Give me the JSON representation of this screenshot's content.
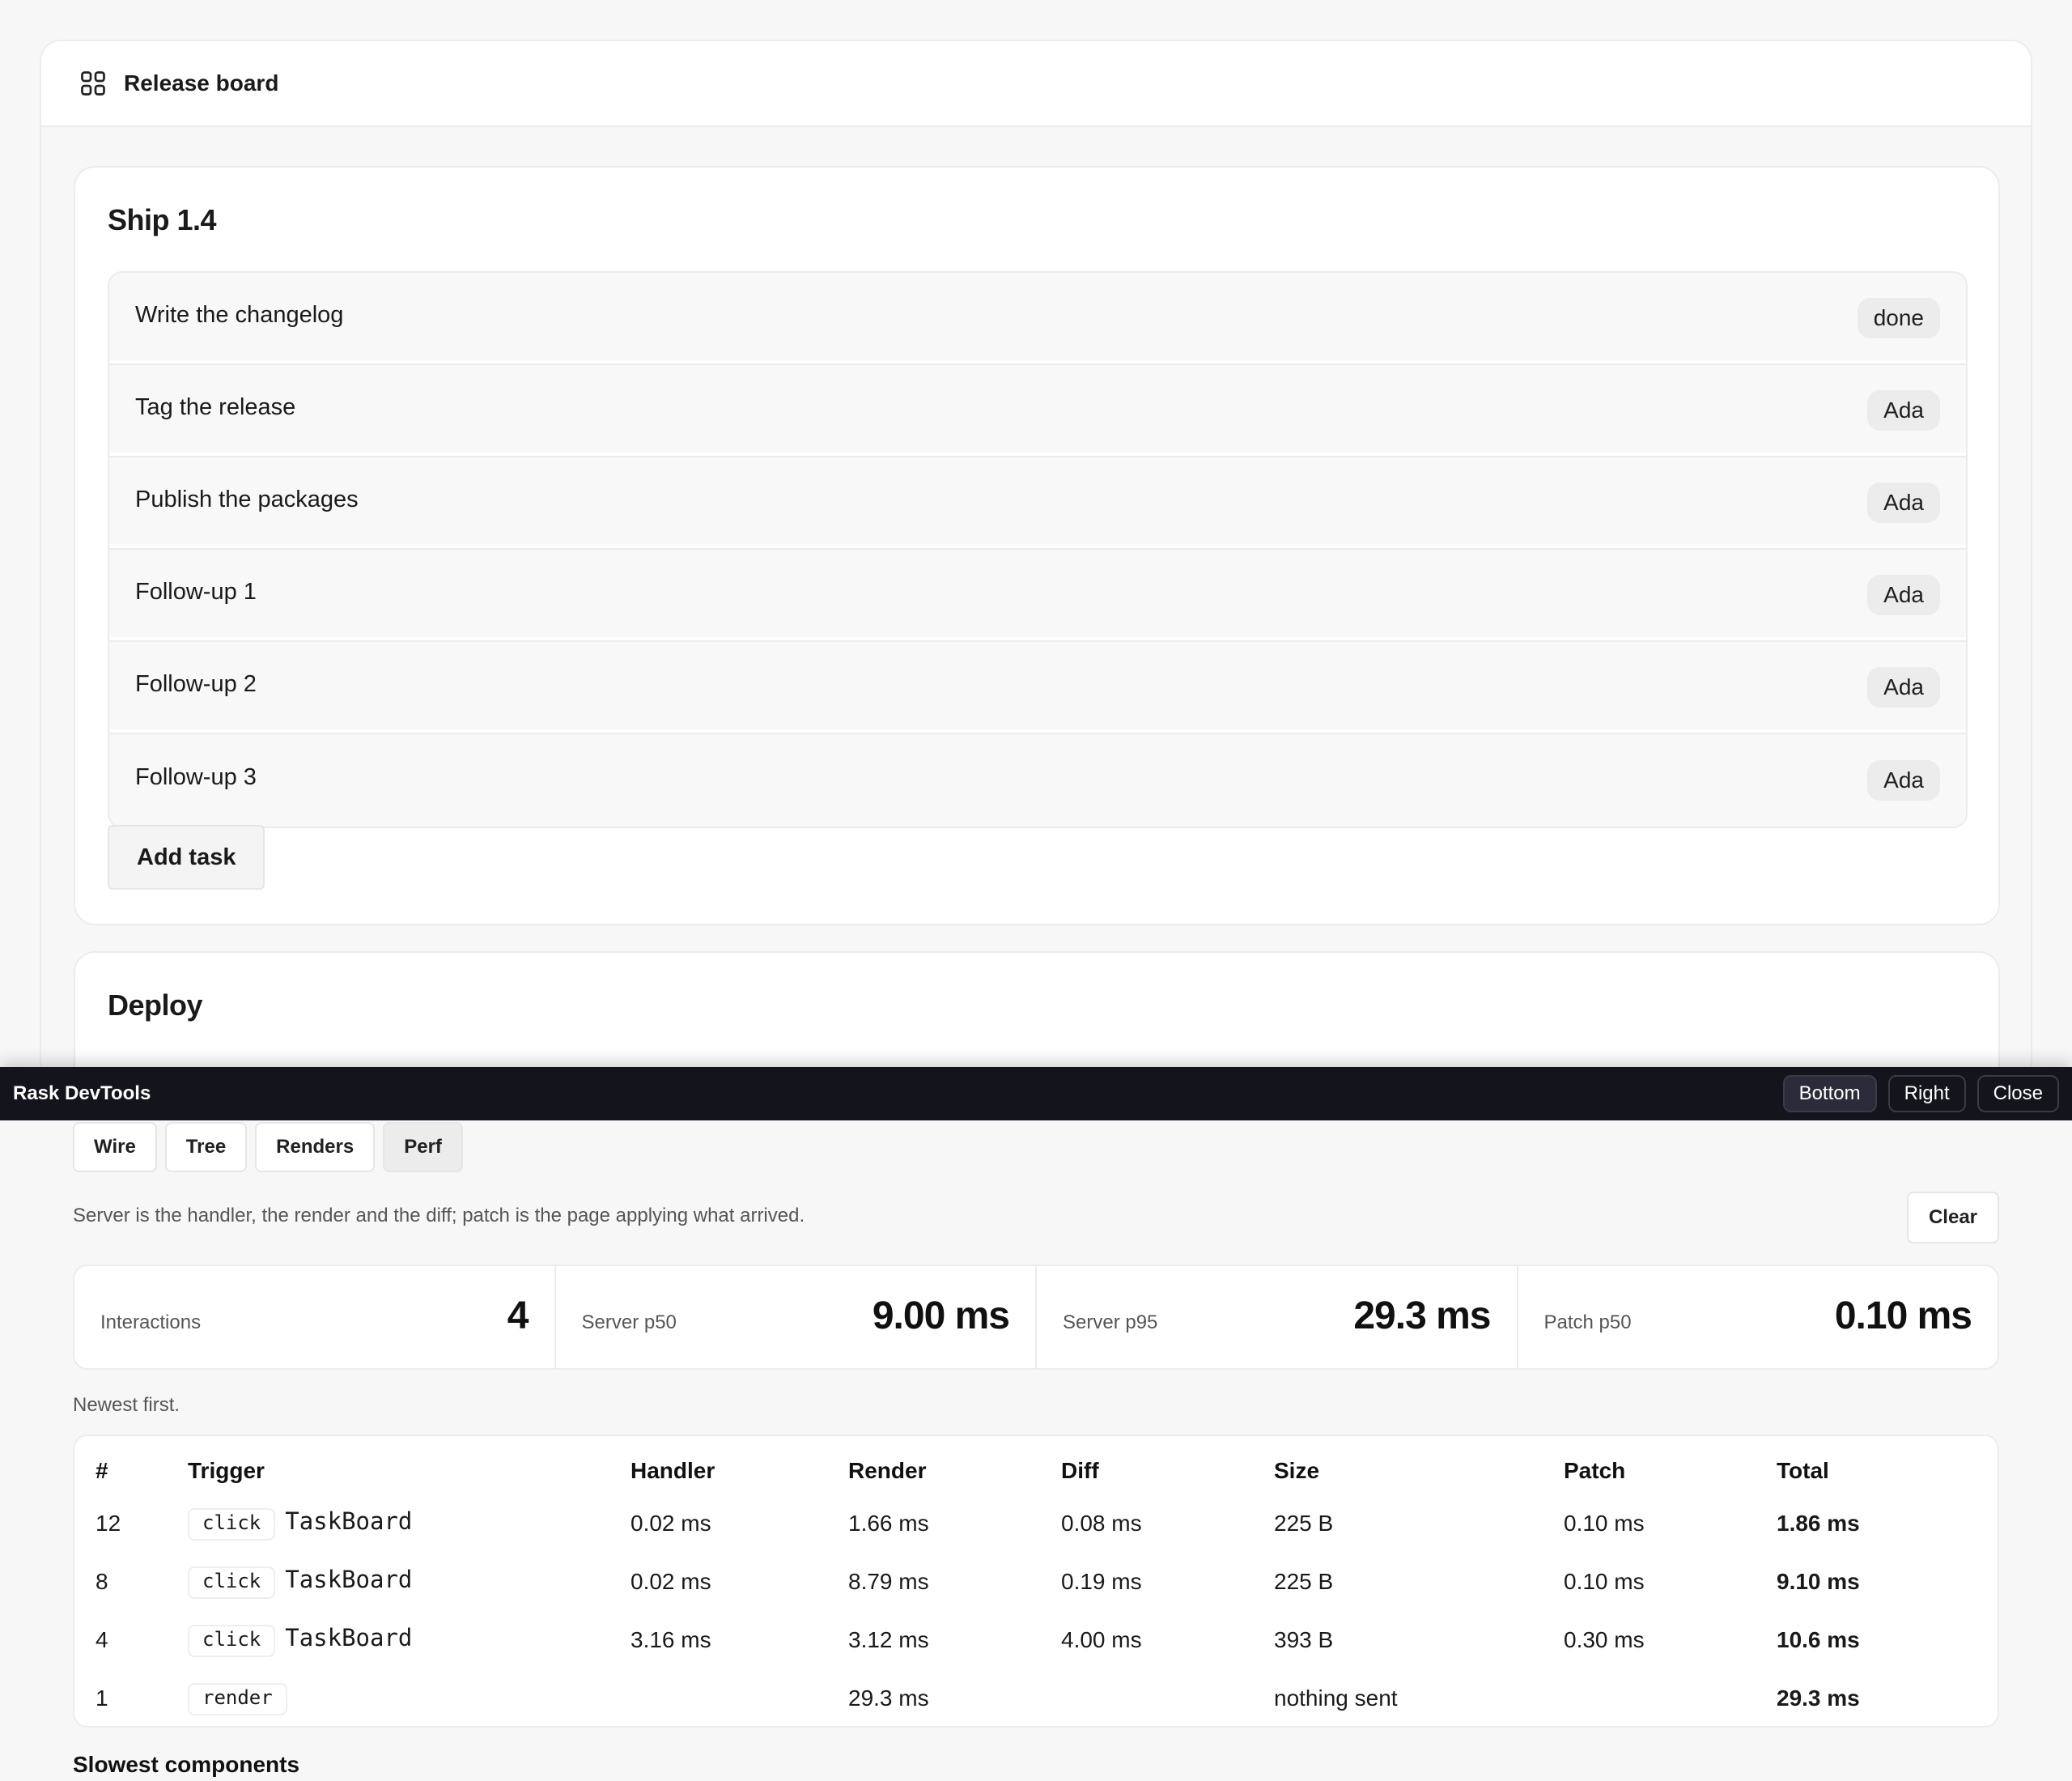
{
  "app": {
    "title": "Release board",
    "icon": "grid-icon"
  },
  "ship": {
    "title": "Ship 1.4",
    "tasks": [
      {
        "text": "Write the changelog",
        "badge": "done"
      },
      {
        "text": "Tag the release",
        "badge": "Ada"
      },
      {
        "text": "Publish the packages",
        "badge": "Ada"
      },
      {
        "text": "Follow-up 1",
        "badge": "Ada"
      },
      {
        "text": "Follow-up 2",
        "badge": "Ada"
      },
      {
        "text": "Follow-up 3",
        "badge": "Ada"
      }
    ],
    "add_label": "Add task"
  },
  "deploy": {
    "title": "Deploy"
  },
  "devtools": {
    "title": "Rask DevTools",
    "actions": {
      "bottom": "Bottom",
      "right": "Right",
      "close": "Close"
    },
    "tabs": [
      "Wire",
      "Tree",
      "Renders",
      "Perf"
    ],
    "active_tab": "Perf",
    "description": "Server is the handler, the render and the diff; patch is the page applying what arrived.",
    "clear_label": "Clear",
    "stats": [
      {
        "label": "Interactions",
        "value": "4"
      },
      {
        "label": "Server p50",
        "value": "9.00 ms"
      },
      {
        "label": "Server p95",
        "value": "29.3 ms"
      },
      {
        "label": "Patch p50",
        "value": "0.10 ms"
      }
    ],
    "order_note": "Newest first.",
    "table": {
      "columns": [
        "#",
        "Trigger",
        "Handler",
        "Render",
        "Diff",
        "Size",
        "Patch",
        "Total"
      ],
      "rows": [
        {
          "num": "12",
          "event": "click",
          "component": "TaskBoard",
          "handler": "0.02 ms",
          "render": "1.66 ms",
          "diff": "0.08 ms",
          "size": "225 B",
          "patch": "0.10 ms",
          "total": "1.86 ms"
        },
        {
          "num": "8",
          "event": "click",
          "component": "TaskBoard",
          "handler": "0.02 ms",
          "render": "8.79 ms",
          "diff": "0.19 ms",
          "size": "225 B",
          "patch": "0.10 ms",
          "total": "9.10 ms"
        },
        {
          "num": "4",
          "event": "click",
          "component": "TaskBoard",
          "handler": "3.16 ms",
          "render": "3.12 ms",
          "diff": "4.00 ms",
          "size": "393 B",
          "patch": "0.30 ms",
          "total": "10.6 ms"
        },
        {
          "num": "1",
          "event": "render",
          "component": "",
          "handler": "",
          "render": "29.3 ms",
          "diff": "",
          "size": "nothing sent",
          "patch": "",
          "total": "29.3 ms"
        }
      ]
    },
    "slowest_title": "Slowest components"
  }
}
